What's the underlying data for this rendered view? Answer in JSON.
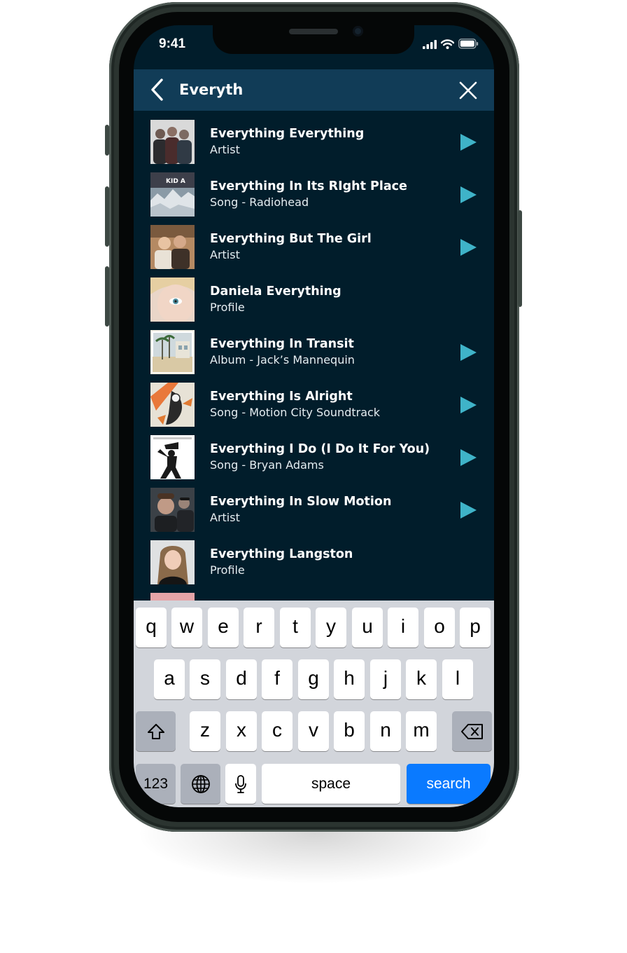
{
  "status_bar": {
    "time": "9:41"
  },
  "header": {
    "query": "Everyth"
  },
  "results": [
    {
      "title": "Everything Everything",
      "subtitle": "Artist",
      "playable": true
    },
    {
      "title": "Everything In Its RIght Place",
      "subtitle": "Song - Radiohead",
      "playable": true,
      "art_text": "KID A"
    },
    {
      "title": "Everything But The Girl",
      "subtitle": "Artist",
      "playable": true
    },
    {
      "title": "Daniela Everything",
      "subtitle": "Profile",
      "playable": false
    },
    {
      "title": "Everything In Transit",
      "subtitle": "Album - Jack’s Mannequin",
      "playable": true
    },
    {
      "title": "Everything Is Alright",
      "subtitle": "Song - Motion City Soundtrack",
      "playable": true
    },
    {
      "title": "Everything I Do (I Do It For You)",
      "subtitle": "Song - Bryan Adams",
      "playable": true
    },
    {
      "title": "Everything In Slow Motion",
      "subtitle": "Artist",
      "playable": true
    },
    {
      "title": "Everything Langston",
      "subtitle": "Profile",
      "playable": false
    }
  ],
  "keyboard": {
    "row1": [
      "q",
      "w",
      "e",
      "r",
      "t",
      "y",
      "u",
      "i",
      "o",
      "p"
    ],
    "row2": [
      "a",
      "s",
      "d",
      "f",
      "g",
      "h",
      "j",
      "k",
      "l"
    ],
    "row3": [
      "z",
      "x",
      "c",
      "v",
      "b",
      "n",
      "m"
    ],
    "numbers_label": "123",
    "space_label": "space",
    "search_label": "search"
  },
  "colors": {
    "screen_bg": "#011d2b",
    "header_bg": "#113c57",
    "play_accent": "#3fb3c8",
    "search_key": "#0a7aff"
  },
  "icons": [
    "chevron-left-icon",
    "close-icon",
    "play-icon",
    "shift-icon",
    "backspace-icon",
    "globe-icon",
    "microphone-icon",
    "signal-icon",
    "wifi-icon",
    "battery-icon"
  ]
}
